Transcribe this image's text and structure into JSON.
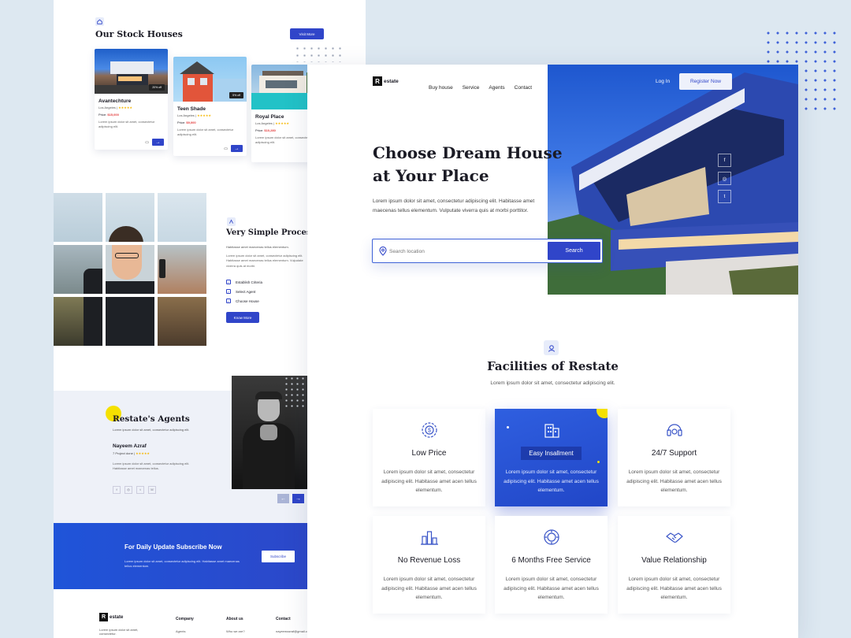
{
  "colors": {
    "accent": "#3045c9",
    "bg": "#dde8f1",
    "yellow": "#f5e100"
  },
  "back": {
    "stock": {
      "title": "Our Stock Houses",
      "visit_btn": "Visit More",
      "cards": [
        {
          "title": "Avantechture",
          "location": "Los Angeles |",
          "price_label": "Price:",
          "price": "$15,000",
          "tag": "20% off",
          "desc": "Lorem ipsum dolor sit amet, consectetur adipiscing elit."
        },
        {
          "title": "Teen Shade",
          "location": "Los Angeles |",
          "price_label": "Price:",
          "price": "$9,000",
          "tag": "5% off",
          "desc": "Lorem ipsum dolor sit amet, consectetur adipiscing elit."
        },
        {
          "title": "Royal Place",
          "location": "Los Angeles |",
          "price_label": "Price:",
          "price": "$10,280",
          "tag": "",
          "desc": "Lorem ipsum dolor sit amet, consectetur adipiscing elit."
        }
      ]
    },
    "process": {
      "title": "Very Simple Process",
      "p1": "Habitasse amet maecenas tellus elementum.",
      "p2": "Lorem ipsum dolor sit amet, consectetur adipiscing elit. Habitasse amet maecenas tellus elementum. Vulputate viverra quis at morbi.",
      "items": [
        "Establish Criteria",
        "Select Agent",
        "Choose House"
      ],
      "btn": "Know More"
    },
    "agents": {
      "title": "Restate's Agents",
      "sub": "Lorem ipsum dolor sit amet, consectetur adipiscing elit.",
      "name": "Nayeem Azraf",
      "exp": "7 Project done |",
      "desc": "Lorem ipsum dolor sit amet, consectetur adipiscing elit. Habitasse amet maecenas tellus."
    },
    "subscribe": {
      "title": "For Daily Update Subscribe Now",
      "desc": "Lorem ipsum dolor sit amet, consectetur adipiscing elit. Habitasse amet maecenas tellus elementum.",
      "btn": "Subscribe"
    },
    "footer": {
      "logo_letter": "R",
      "logo_text": "estate",
      "desc": "Lorem ipsum dolor sit amet, consectetur.",
      "cols": [
        {
          "title": "Company",
          "item": "Agents"
        },
        {
          "title": "About us",
          "item": "Who we are?"
        },
        {
          "title": "Contact",
          "item": "nayeemazraf@gmail.com"
        }
      ]
    }
  },
  "front": {
    "logo_letter": "R",
    "logo_text": "estate",
    "nav": [
      "Buy house",
      "Service",
      "Agents",
      "Contact"
    ],
    "login": "Log In",
    "register": "Register Now",
    "hero": {
      "title_1": "Choose Dream House",
      "title_2": "at Your Place",
      "desc": "Lorem ipsum dolor sit amet, consectetur adipiscing elit. Habitasse amet maecenas tellus elementum. Vulputate viverra quis at morbi porttitor.",
      "search_placeholder": "Search location",
      "search_btn": "Search"
    },
    "social": [
      "f",
      "◎",
      "t"
    ],
    "facilities": {
      "title": "Facilities of Restate",
      "sub": "Lorem ipsum dolor sit amet, consectetur adipiscing elit.",
      "cards": [
        {
          "title": "Low Price",
          "desc": "Lorem ipsum dolor sit amet, consectetur adipiscing elit. Habitasse amet acen tellus elementum."
        },
        {
          "title": "Easy Insallment",
          "desc": "Lorem ipsum dolor sit amet, consectetur adipiscing elit. Habitasse amet acen tellus elementum."
        },
        {
          "title": "24/7 Support",
          "desc": "Lorem ipsum dolor sit amet, consectetur adipiscing elit. Habitasse amet acen tellus elementum."
        },
        {
          "title": "No Revenue Loss",
          "desc": "Lorem ipsum dolor sit amet, consectetur adipiscing elit. Habitasse amet acen tellus elementum."
        },
        {
          "title": "6 Months Free Service",
          "desc": "Lorem ipsum dolor sit amet, consectetur adipiscing elit. Habitasse amet acen tellus elementum."
        },
        {
          "title": "Value Relationship",
          "desc": "Lorem ipsum dolor sit amet, consectetur adipiscing elit. Habitasse amet acen tellus elementum."
        }
      ]
    }
  }
}
